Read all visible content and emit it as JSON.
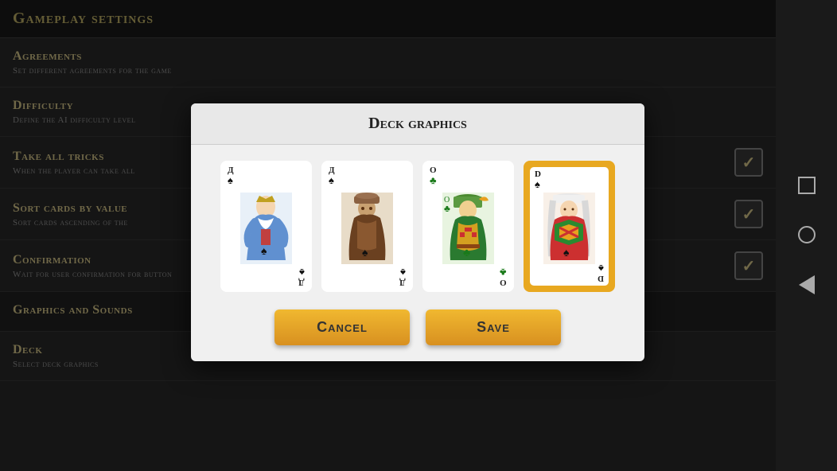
{
  "page": {
    "title": "Gameplay settings"
  },
  "settings": [
    {
      "id": "agreements",
      "title": "Agreements",
      "desc": "Set different agreements for the game",
      "has_checkbox": false
    },
    {
      "id": "difficulty",
      "title": "Difficulty",
      "desc": "Define the AI difficulty level",
      "has_checkbox": false
    },
    {
      "id": "take_all_tricks",
      "title": "Take all tricks",
      "desc": "When the player can take all",
      "has_checkbox": true,
      "checked": true
    },
    {
      "id": "sort_cards_by_value",
      "title": "Sort cards by value",
      "desc": "Sort cards ascending of the",
      "has_checkbox": true,
      "checked": true
    },
    {
      "id": "confirmation",
      "title": "Confirmation",
      "desc": "Wait for user confirmation for button",
      "has_checkbox": true,
      "checked": true
    },
    {
      "id": "graphics_and_sounds",
      "title": "Graphics and Sounds",
      "desc": "",
      "has_checkbox": false,
      "is_section": true
    },
    {
      "id": "deck",
      "title": "Deck",
      "desc": "Select deck graphics",
      "has_checkbox": false
    }
  ],
  "dialog": {
    "title": "Deck graphics",
    "cards": [
      {
        "id": "card1",
        "label": "Д",
        "suit": "♠",
        "style": "blue",
        "selected": false
      },
      {
        "id": "card2",
        "label": "Д",
        "suit": "♠",
        "style": "brown",
        "selected": false
      },
      {
        "id": "card3",
        "label": "О",
        "suit": "♣",
        "style": "green",
        "selected": false
      },
      {
        "id": "card4",
        "label": "D",
        "suit": "♠",
        "style": "colorful",
        "selected": true
      }
    ],
    "cancel_label": "Cancel",
    "save_label": "Save"
  },
  "android_nav": {
    "square_title": "square-nav",
    "circle_title": "circle-nav",
    "triangle_title": "back-nav"
  }
}
